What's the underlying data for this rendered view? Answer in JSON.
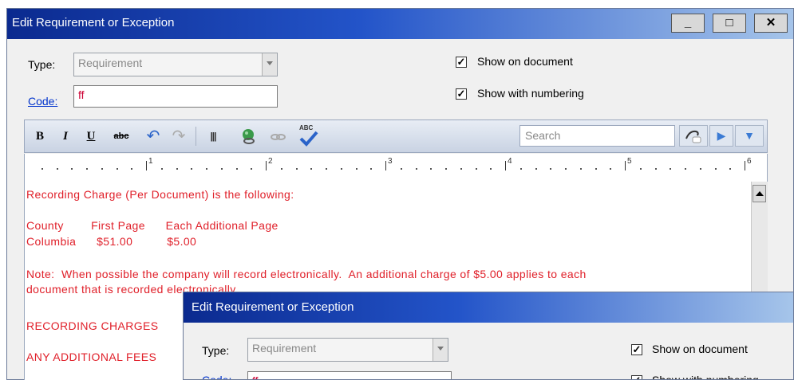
{
  "window_back": {
    "title": "Edit Requirement or Exception",
    "minimize": "_",
    "maximize": "□",
    "close": "✕",
    "type_label": "Type:",
    "type_value": "Requirement",
    "code_label": "Code:",
    "code_value": "ff",
    "show_on_document": "Show on document",
    "show_with_numbering": "Show with numbering",
    "check_mark": "✓"
  },
  "toolbar": {
    "bold": "B",
    "italic": "I",
    "underline": "U",
    "strike": "abc",
    "undo": "↶",
    "redo": "↷",
    "columns": "|||",
    "spell": "ABC",
    "search_placeholder": "Search",
    "next": "▶",
    "more": "▼"
  },
  "ruler": {
    "numbers": [
      "1",
      "2",
      "3",
      "4",
      "5",
      "6"
    ]
  },
  "editor": {
    "lines": [
      "Recording Charge (Per Document) is the following:",
      "County        First Page      Each Additional Page",
      "Columbia      $51.00          $5.00",
      "Note:  When possible the company will record electronically.  An additional charge of $5.00 applies to each",
      "document that is recorded electronically.",
      "RECORDING CHARGES",
      "ANY ADDITIONAL FEES"
    ]
  },
  "window_front": {
    "title": "Edit Requirement or Exception",
    "type_label": "Type:",
    "type_value": "Requirement",
    "code_label": "Code:",
    "code_value": "ff",
    "show_on_document": "Show on document",
    "show_with_numbering": "Show with numbering",
    "check_mark": "✓"
  }
}
